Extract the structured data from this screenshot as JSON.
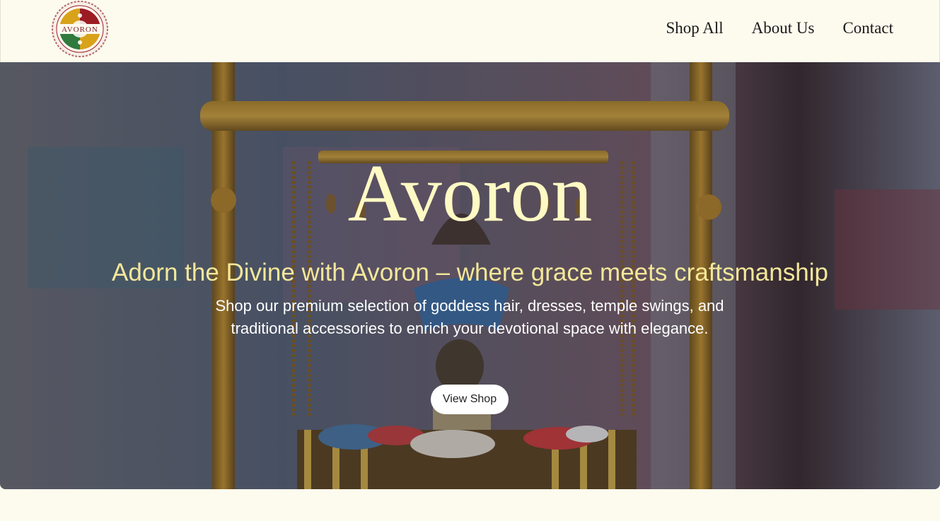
{
  "brand": {
    "logo_text": "AVORON"
  },
  "nav": {
    "items": [
      {
        "label": "Shop All"
      },
      {
        "label": "About Us"
      },
      {
        "label": "Contact"
      }
    ]
  },
  "hero": {
    "title": "Avoron",
    "subtitle": "Adorn the Divine with Avoron – where grace meets craftsmanship",
    "description": "Shop our premium selection of goddess hair, dresses, temple swings, and traditional accessories to enrich your devotional space with elegance.",
    "button_label": "View Shop"
  },
  "colors": {
    "page_background": "#fdfbee",
    "hero_title": "#fff9c4",
    "hero_subtitle": "#f3e79a",
    "hero_description": "#ffffff",
    "button_background": "#ffffff",
    "logo_red": "#9b1c23",
    "logo_gold": "#d9a21b",
    "logo_green": "#2f7a3c"
  }
}
